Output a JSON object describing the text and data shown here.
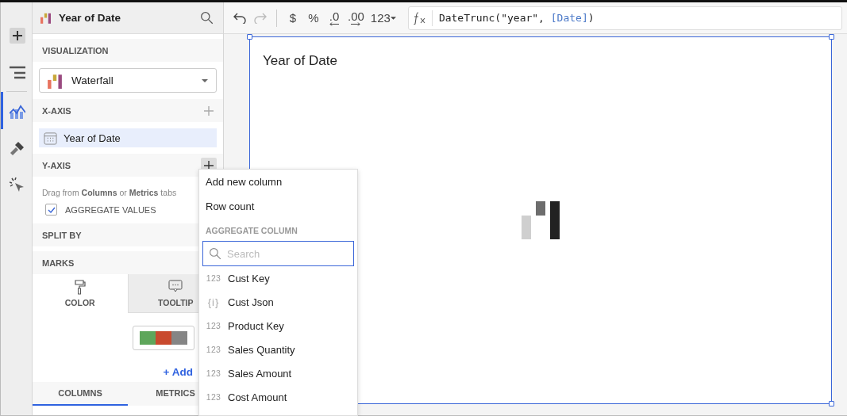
{
  "rail": [
    {
      "kind": "add",
      "selected": false
    },
    {
      "kind": "outline",
      "selected": false
    },
    {
      "kind": "chart",
      "selected": true
    },
    {
      "kind": "brush",
      "selected": false
    },
    {
      "kind": "actions",
      "selected": false
    }
  ],
  "panel": {
    "title": "Year of Date",
    "visualization": {
      "heading": "VISUALIZATION",
      "value": "Waterfall"
    },
    "x_axis": {
      "heading": "X-AXIS",
      "items": [
        {
          "label": "Year of Date"
        }
      ]
    },
    "y_axis": {
      "heading": "Y-AXIS",
      "add_active": true,
      "hint": "Drag from **Columns** or **Metrics** tabs",
      "aggregate": {
        "label": "AGGREGATE VALUES",
        "checked": true
      }
    },
    "split_by": {
      "heading": "SPLIT BY"
    },
    "marks": {
      "heading": "MARKS",
      "tabs": [
        {
          "label": "COLOR",
          "selected": true
        },
        {
          "label": "TOOLTIP",
          "selected": false
        }
      ],
      "palette": [
        {
          "color": "#5ea65b"
        },
        {
          "color": "#c94a2e"
        },
        {
          "color": "#858585"
        }
      ],
      "add_label": "+ Add"
    },
    "bottom_tabs": [
      {
        "label": "COLUMNS",
        "selected": true
      },
      {
        "label": "METRICS",
        "selected": false
      }
    ]
  },
  "toolbar": {
    "undo_enabled": true,
    "redo_enabled": false,
    "currency": "$",
    "percent": "%",
    "decrease_decimals": ".0",
    "increase_decimals": ".00",
    "number_format": "123",
    "formula": [
      {
        "kind": "code",
        "text": "DateTrunc(\"year\", "
      },
      {
        "kind": "column",
        "text": "[Date]"
      },
      {
        "kind": "code",
        "text": ")"
      }
    ]
  },
  "canvas": {
    "element_title": "Year of Date"
  },
  "menu": {
    "items": [
      {
        "label": "Add new column"
      },
      {
        "label": "Row count"
      }
    ],
    "section": "AGGREGATE COLUMN",
    "search_placeholder": "Search",
    "columns": [
      {
        "kind": "number",
        "type_label": "123",
        "label": "Cust Key"
      },
      {
        "kind": "json",
        "type_label": "{i}",
        "label": "Cust Json"
      },
      {
        "kind": "number",
        "type_label": "123",
        "label": "Product Key"
      },
      {
        "kind": "number",
        "type_label": "123",
        "label": "Sales Quantity"
      },
      {
        "kind": "number",
        "type_label": "123",
        "label": "Sales Amount"
      },
      {
        "kind": "number",
        "type_label": "123",
        "label": "Cost Amount"
      }
    ]
  }
}
